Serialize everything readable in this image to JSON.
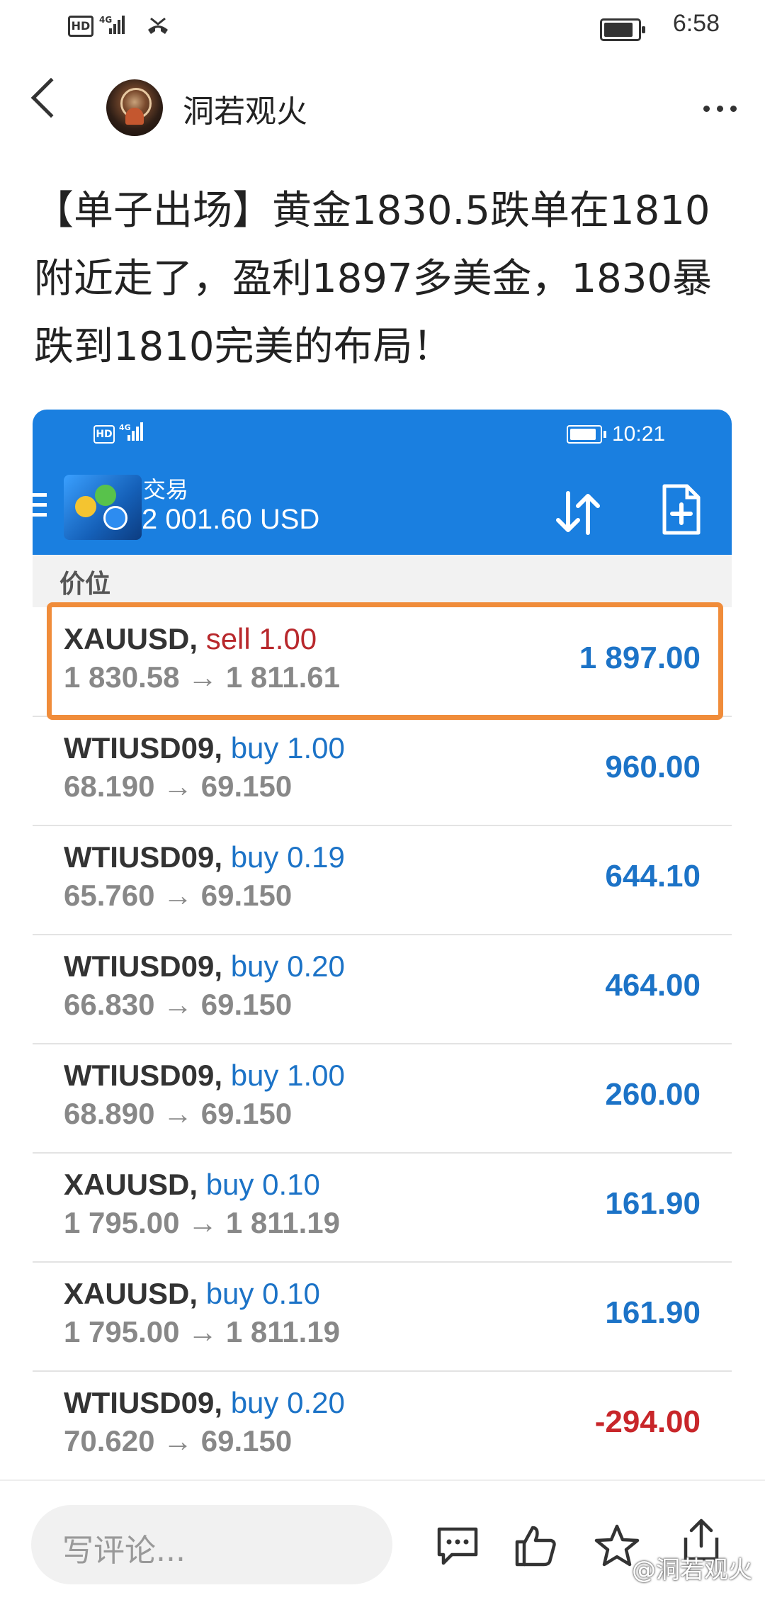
{
  "status_bar": {
    "network": "HD",
    "signal": "4G",
    "time": "6:58"
  },
  "header": {
    "author": "洞若观火"
  },
  "post": {
    "text": "【单子出场】黄金1830.5跌单在1810附近走了，盈利1897多美金，1830暴跌到1810完美的布局！"
  },
  "screenshot": {
    "status_bar": {
      "network": "HD",
      "signal": "4G",
      "time": "10:21"
    },
    "title": "交易",
    "balance": "2 001.60 USD",
    "section_header": "价位",
    "trades": [
      {
        "symbol": "XAUUSD,",
        "side": "sell 1.00",
        "type": "sell",
        "prices": "1 830.58 → 1 811.61",
        "profit": "1 897.00",
        "profit_sign": "pos"
      },
      {
        "symbol": "WTIUSD09,",
        "side": "buy 1.00",
        "type": "buy",
        "prices": "68.190 → 69.150",
        "profit": "960.00",
        "profit_sign": "pos"
      },
      {
        "symbol": "WTIUSD09,",
        "side": "buy 0.19",
        "type": "buy",
        "prices": "65.760 → 69.150",
        "profit": "644.10",
        "profit_sign": "pos"
      },
      {
        "symbol": "WTIUSD09,",
        "side": "buy 0.20",
        "type": "buy",
        "prices": "66.830 → 69.150",
        "profit": "464.00",
        "profit_sign": "pos"
      },
      {
        "symbol": "WTIUSD09,",
        "side": "buy 1.00",
        "type": "buy",
        "prices": "68.890 → 69.150",
        "profit": "260.00",
        "profit_sign": "pos"
      },
      {
        "symbol": "XAUUSD,",
        "side": "buy 0.10",
        "type": "buy",
        "prices": "1 795.00 → 1 811.19",
        "profit": "161.90",
        "profit_sign": "pos"
      },
      {
        "symbol": "XAUUSD,",
        "side": "buy 0.10",
        "type": "buy",
        "prices": "1 795.00 → 1 811.19",
        "profit": "161.90",
        "profit_sign": "pos"
      },
      {
        "symbol": "WTIUSD09,",
        "side": "buy 0.20",
        "type": "buy",
        "prices": "70.620 → 69.150",
        "profit": "-294.00",
        "profit_sign": "neg"
      }
    ]
  },
  "bottom_bar": {
    "comment_placeholder": "写评论...",
    "icons": [
      "comment-icon",
      "like-icon",
      "star-icon",
      "share-icon"
    ],
    "watermark": "@洞若观火"
  },
  "colors": {
    "app_blue": "#1a7fe0",
    "buy_blue": "#1c73c7",
    "sell_red": "#b8282c",
    "highlight_orange": "#f08c3a"
  }
}
